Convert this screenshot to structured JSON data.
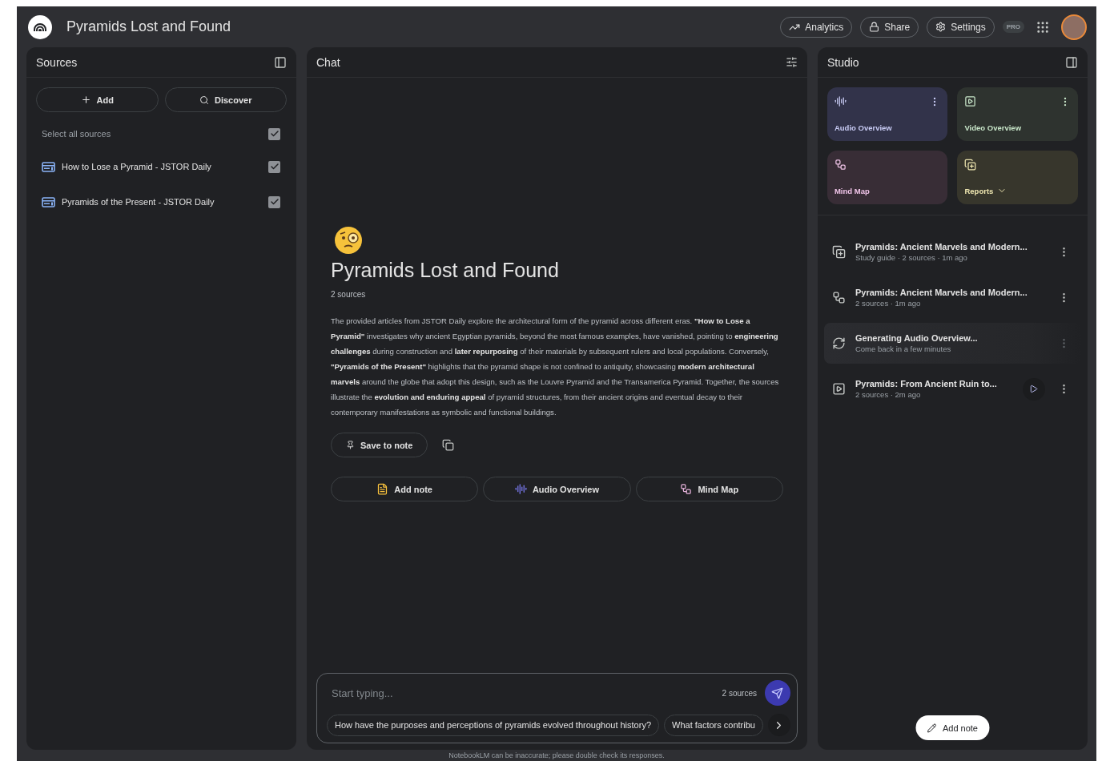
{
  "header": {
    "title": "Pyramids Lost and Found",
    "buttons": [
      {
        "kind": "analytics",
        "label": "Analytics"
      },
      {
        "kind": "share",
        "label": "Share"
      },
      {
        "kind": "settings",
        "label": "Settings"
      }
    ],
    "badge": "PRO"
  },
  "sources": {
    "title": "Sources",
    "buttons": [
      {
        "kind": "add",
        "label": "Add"
      },
      {
        "kind": "discover",
        "label": "Discover"
      }
    ],
    "select_all": {
      "label": "Select all sources",
      "checked": true
    },
    "items": [
      {
        "title": "How to Lose a Pyramid - JSTOR Daily",
        "checked": true
      },
      {
        "title": "Pyramids of the Present - JSTOR Daily",
        "checked": true
      }
    ]
  },
  "chat": {
    "title": "Chat",
    "notebook_title": "Pyramids Lost and Found",
    "source_count": "2 sources",
    "summary": "The provided articles from JSTOR Daily explore the architectural form of the pyramid across different eras. **\"How to Lose a Pyramid\"** investigates why ancient Egyptian pyramids, beyond the most famous examples, have vanished, pointing to **engineering challenges** during construction and **later repurposing** of their materials by subsequent rulers and local populations. Conversely, **\"Pyramids of the Present\"** highlights that the pyramid shape is not confined to antiquity, showcasing **modern architectural marvels** around the globe that adopt this design, such as the Louvre Pyramid and the Transamerica Pyramid. Together, the sources illustrate the **evolution and enduring appeal** of pyramid structures, from their ancient origins and eventual decay to their contemporary manifestations as symbolic and functional buildings.",
    "save_to_note": "Save to note",
    "quick_actions": [
      {
        "kind": "note",
        "label": "Add note"
      },
      {
        "kind": "audio",
        "label": "Audio Overview"
      },
      {
        "kind": "mindmap",
        "label": "Mind Map"
      }
    ],
    "input": {
      "placeholder": "Start typing...",
      "source_count": "2 sources"
    },
    "suggestions": [
      "How have the purposes and perceptions of pyramids evolved throughout history?",
      "What factors contribu"
    ],
    "disclaimer": "NotebookLM can be inaccurate; please double check its responses."
  },
  "studio": {
    "title": "Studio",
    "tiles": [
      {
        "kind": "audio",
        "label": "Audio Overview",
        "menu": true,
        "dropdown": false
      },
      {
        "kind": "video",
        "label": "Video Overview",
        "menu": true,
        "dropdown": false
      },
      {
        "kind": "mindmap",
        "label": "Mind Map",
        "menu": false,
        "dropdown": false
      },
      {
        "kind": "reports",
        "label": "Reports",
        "menu": false,
        "dropdown": true
      }
    ],
    "notes": [
      {
        "kind": "reports",
        "title": "Pyramids: Ancient Marvels and Modern...",
        "meta": "Study guide · 2 sources · 1m ago",
        "pending": false,
        "playable": false
      },
      {
        "kind": "mindmap",
        "title": "Pyramids: Ancient Marvels and Modern...",
        "meta": "2 sources · 1m ago",
        "pending": false,
        "playable": false
      },
      {
        "kind": "generating",
        "title": "Generating Audio Overview...",
        "meta": "Come back in a few minutes",
        "pending": true,
        "playable": false
      },
      {
        "kind": "video",
        "title": "Pyramids: From Ancient Ruin to...",
        "meta": "2 sources · 2m ago",
        "pending": false,
        "playable": true
      }
    ],
    "add_note": "Add note"
  }
}
